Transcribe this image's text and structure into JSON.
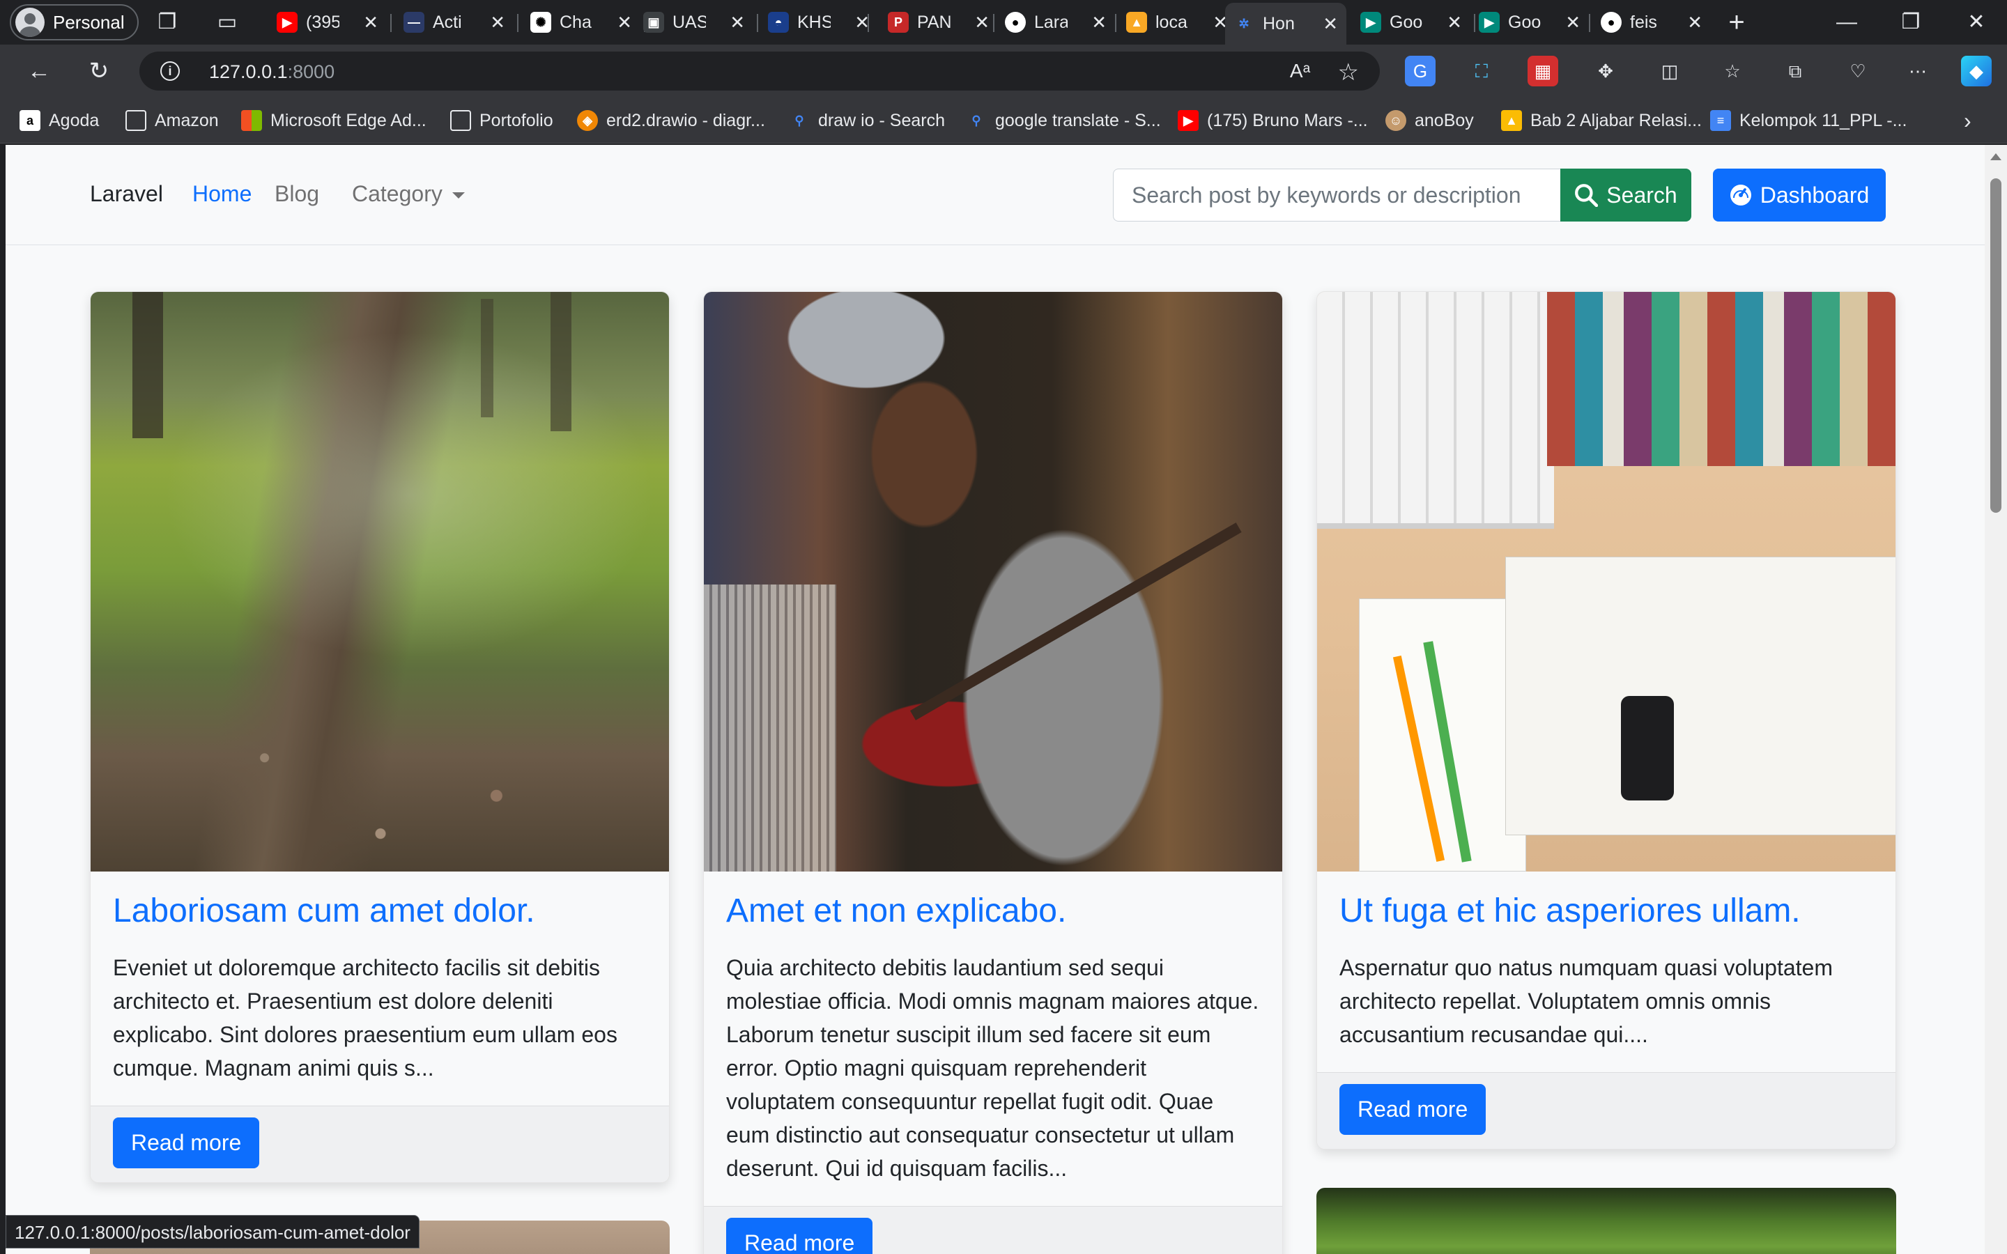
{
  "browser": {
    "profile_label": "Personal",
    "tabs": [
      {
        "label": "(395",
        "icon": "youtube-icon",
        "color": "#ff0000"
      },
      {
        "label": "Acti",
        "icon": "activity-icon",
        "color": "#2b3a67"
      },
      {
        "label": "Cha",
        "icon": "chatgpt-icon",
        "color": "#ffffff"
      },
      {
        "label": "UAS",
        "icon": "uas-icon",
        "color": "#3c4043"
      },
      {
        "label": "KHS",
        "icon": "khs-icon",
        "color": "#1a3e8c"
      },
      {
        "label": "PAN",
        "icon": "pan-icon",
        "color": "#c62828"
      },
      {
        "label": "Lara",
        "icon": "github-icon",
        "color": "#ffffff"
      },
      {
        "label": "loca",
        "icon": "localhost-icon",
        "color": "#f9a825"
      },
      {
        "label": "Hon",
        "icon": "laravel-page-icon",
        "color": "#4285f4"
      },
      {
        "label": "Goo",
        "icon": "google-meet-icon",
        "color": "#00897b"
      },
      {
        "label": "Goo",
        "icon": "google-meet-icon",
        "color": "#00897b"
      },
      {
        "label": "feis",
        "icon": "github-icon",
        "color": "#ffffff"
      }
    ],
    "url_host": "127.0.0.1",
    "url_port": ":8000",
    "bookmarks": [
      {
        "label": "Agoda",
        "icon": "agoda-icon",
        "color": "#ffffff"
      },
      {
        "label": "Amazon",
        "icon": "page-icon",
        "color": "#e8eaed"
      },
      {
        "label": "Microsoft Edge Ad...",
        "icon": "microsoft-icon",
        "color": "#f25022"
      },
      {
        "label": "Portofolio",
        "icon": "page-icon",
        "color": "#e8eaed"
      },
      {
        "label": "erd2.drawio - diagr...",
        "icon": "drawio-icon",
        "color": "#f08705"
      },
      {
        "label": "draw io - Search",
        "icon": "search-icon",
        "color": "#4285f4"
      },
      {
        "label": "google translate - S...",
        "icon": "search-icon",
        "color": "#4285f4"
      },
      {
        "label": "(175) Bruno Mars -...",
        "icon": "youtube-icon",
        "color": "#ff0000"
      },
      {
        "label": "anoBoy",
        "icon": "anoboy-icon",
        "color": "#c49a6c"
      },
      {
        "label": "Bab 2 Aljabar Relasi...",
        "icon": "google-drive-icon",
        "color": "#fbbc04"
      },
      {
        "label": "Kelompok 11_PPL -...",
        "icon": "google-docs-icon",
        "color": "#4285f4"
      }
    ],
    "status_url": "127.0.0.1:8000/posts/laboriosam-cum-amet-dolor"
  },
  "navbar": {
    "brand": "Laravel",
    "home": "Home",
    "blog": "Blog",
    "category": "Category",
    "search_placeholder": "Search post by keywords or description",
    "search_button": "Search",
    "dashboard_button": "Dashboard"
  },
  "posts": [
    {
      "title": "Laboriosam cum amet dolor.",
      "excerpt": "Eveniet ut doloremque architecto facilis sit debitis architecto et. Praesentium est dolore deleniti explicabo. Sint dolores praesentium eum ullam eos cumque. Magnam animi quis s...",
      "button": "Read more",
      "image": "forest-path-photo"
    },
    {
      "title": "Amet et non explicabo.",
      "excerpt": "Quia architecto debitis laudantium sed sequi molestiae officia. Modi omnis magnam maiores atque. Laborum tenetur suscipit illum sed facere sit eum error. Optio magni quisquam reprehenderit voluptatem consequuntur repellat fugit odit. Quae eum distinctio aut consequatur consectetur ut ullam deserunt. Qui id quisquam facilis...",
      "button": "Read more",
      "image": "guitarist-photo"
    },
    {
      "title": "Ut fuga et hic asperiores ullam.",
      "excerpt": "Aspernatur quo natus numquam quasi voluptatem architecto repellat. Voluptatem omnis omnis accusantium recusandae qui....",
      "button": "Read more",
      "image": "desk-books-photo"
    }
  ],
  "colors": {
    "primary": "#0d6efd",
    "success": "#198754",
    "page_bg": "#f8f9fa"
  }
}
